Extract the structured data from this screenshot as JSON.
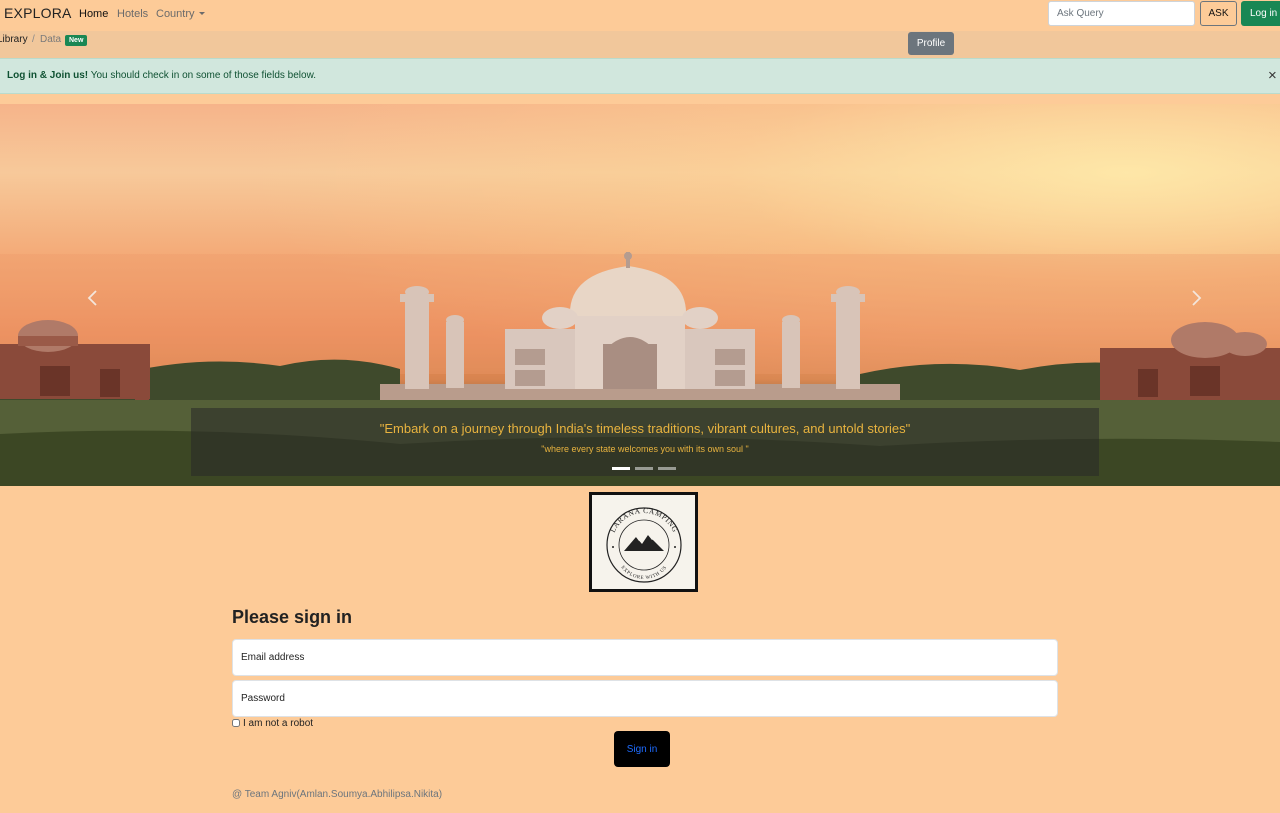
{
  "navbar": {
    "brand": "EXPLORA",
    "links": [
      {
        "label": "Home",
        "active": true
      },
      {
        "label": "Hotels",
        "active": false
      },
      {
        "label": "Country",
        "active": false,
        "dropdown": true
      }
    ],
    "search_placeholder": "Ask Query",
    "ask_label": "ASK",
    "login_label": "Log in"
  },
  "breadcrumb": {
    "items": [
      "Library",
      "Data"
    ],
    "separator": "/",
    "badge": "New"
  },
  "profile_button": "Profile",
  "alert": {
    "strong": "Log in & Join us!",
    "text": " You should check in on some of those fields below.",
    "close": "×"
  },
  "carousel": {
    "caption_title": "\"Embark on a journey through India's timeless traditions, vibrant cultures, and untold stories\"",
    "caption_sub": "\"where every state welcomes you with its own soul \"",
    "slide_count": 3,
    "active_slide": 1
  },
  "logo": {
    "text_top": "LARANA CAMPING",
    "text_bottom": "EXPLORE WITH US"
  },
  "form": {
    "title": "Please sign in",
    "email_placeholder": "Email address",
    "password_placeholder": "Password",
    "checkbox_label": "I am not a robot",
    "submit_label": "Sign in"
  },
  "footer": "@ Team Agniv(Amlan.Soumya.Abhilipsa.Nikita)",
  "colors": {
    "page_bg": "#fdcb98",
    "success": "#198754",
    "secondary": "#6c757d",
    "alert_bg": "#d1e7dd",
    "caption_text": "#e8b33f",
    "signin_text": "#1e6cff"
  }
}
